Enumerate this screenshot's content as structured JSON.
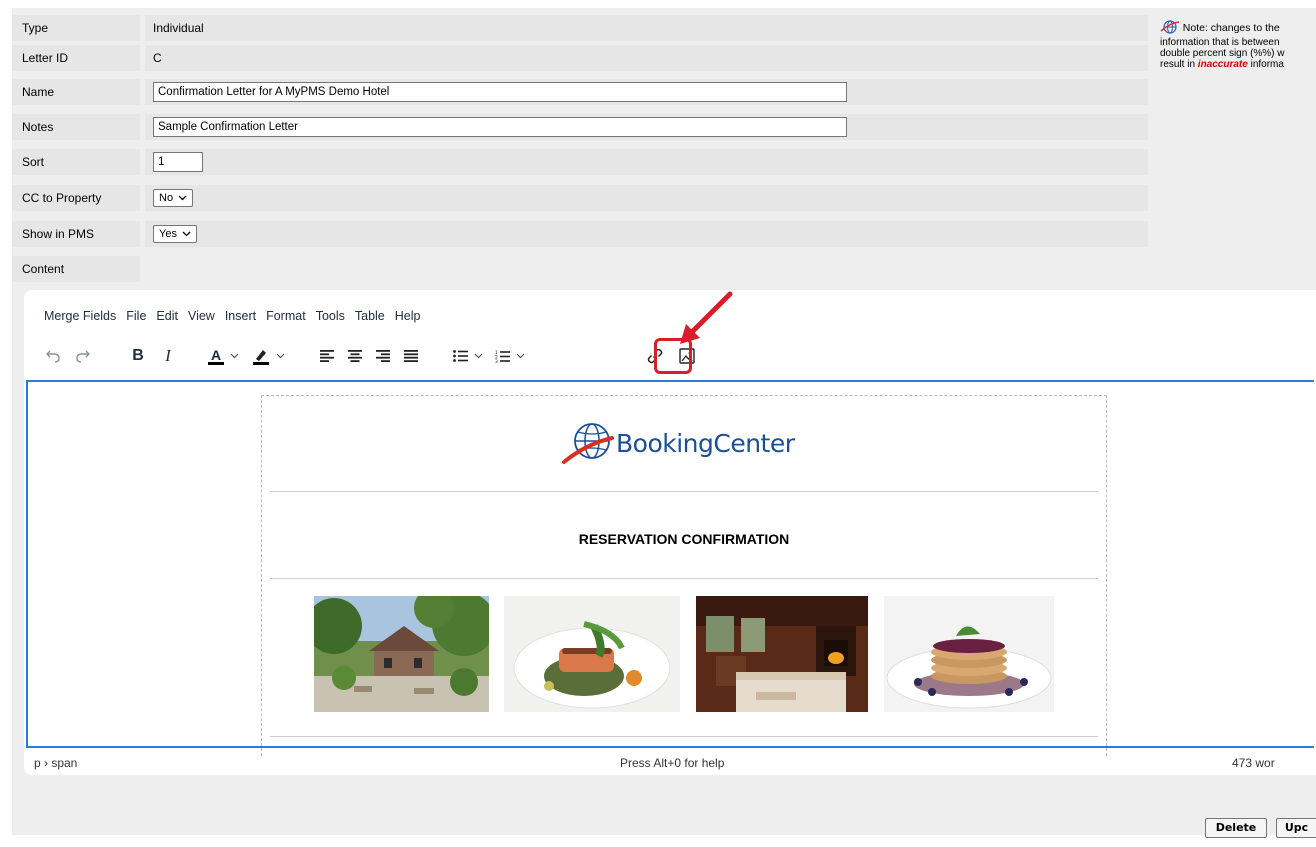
{
  "form": {
    "type": {
      "label": "Type",
      "value": "Individual"
    },
    "letter_id": {
      "label": "Letter ID",
      "value": "C"
    },
    "name": {
      "label": "Name",
      "value": "Confirmation Letter for A MyPMS Demo Hotel"
    },
    "notes": {
      "label": "Notes",
      "value": "Sample Confirmation Letter"
    },
    "sort": {
      "label": "Sort",
      "value": "1"
    },
    "cc_to_property": {
      "label": "CC to Property",
      "value": "No"
    },
    "show_in_pms": {
      "label": "Show in PMS",
      "value": "Yes"
    },
    "content": {
      "label": "Content"
    }
  },
  "note": {
    "line1": "Note: changes to the",
    "line2": "information that is between",
    "line3": "double percent sign (%%) w",
    "line4_prefix": "result in ",
    "line4_emphasis": "inaccurate",
    "line4_suffix": " informa"
  },
  "editor": {
    "menu": [
      "Merge Fields",
      "File",
      "Edit",
      "View",
      "Insert",
      "Format",
      "Tools",
      "Table",
      "Help"
    ],
    "toolbar_icons": [
      "undo-icon",
      "redo-icon",
      "bold-icon",
      "italic-icon",
      "text-color-icon",
      "highlight-color-icon",
      "align-left-icon",
      "align-center-icon",
      "align-right-icon",
      "justify-icon",
      "bullet-list-icon",
      "numbered-list-icon",
      "link-icon",
      "image-icon"
    ],
    "bold_glyph": "B",
    "italic_glyph": "I",
    "text_color_glyph": "A",
    "text_color": "#000000",
    "highlight_color": "#000000",
    "highlighted_tool": "image-icon",
    "highlight_color_annotation": "#d81e2a"
  },
  "letter": {
    "logo_text": "BookingCenter",
    "heading": "RESERVATION CONFIRMATION",
    "photos": [
      "garden-photo",
      "salmon-dish-photo",
      "bedroom-photo",
      "pancakes-photo"
    ]
  },
  "status": {
    "path": "p › span",
    "help": "Press Alt+0 for help",
    "words": "473 wor"
  },
  "buttons": {
    "delete": "Delete",
    "update": "Upc"
  }
}
